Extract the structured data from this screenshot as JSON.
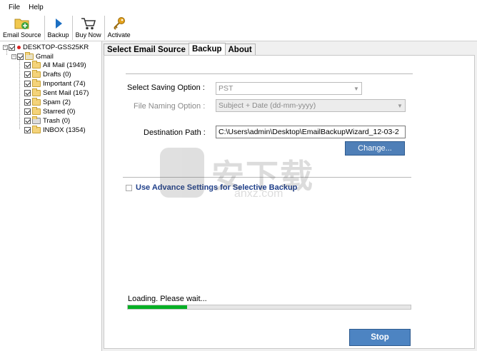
{
  "menu": [
    "File",
    "Help"
  ],
  "toolbar": {
    "email_source": "Email Source",
    "backup": "Backup",
    "buy_now": "Buy Now",
    "activate": "Activate"
  },
  "tree": {
    "root": "DESKTOP-GSS25KR",
    "account": "Gmail",
    "folders": [
      {
        "label": "All Mail (1949)"
      },
      {
        "label": "Drafts (0)"
      },
      {
        "label": "Important (74)"
      },
      {
        "label": "Sent Mail (167)"
      },
      {
        "label": "Spam (2)"
      },
      {
        "label": "Starred (0)"
      },
      {
        "label": "Trash (0)"
      },
      {
        "label": "INBOX (1354)"
      }
    ]
  },
  "tabs": [
    "Select Email Source",
    "Backup",
    "About"
  ],
  "active_tab": "Backup",
  "form": {
    "saving_option_label": "Select Saving Option :",
    "saving_option_value": "PST",
    "naming_option_label": "File Naming Option :",
    "naming_option_value": "Subject + Date (dd-mm-yyyy)",
    "destination_label": "Destination Path :",
    "destination_value": "C:\\Users\\admin\\Desktop\\EmailBackupWizard_12-03-2",
    "change_button": "Change...",
    "advance_settings": "Use Advance Settings for Selective Backup"
  },
  "status": {
    "loading_text": "Loading. Please wait...",
    "progress": 0.21
  },
  "stop_button": "Stop",
  "watermark": {
    "cn": "安下载",
    "en": "anxz.com"
  },
  "colors": {
    "progress_fill": "#06b025",
    "button_blue": "#4f7fb7",
    "link_blue": "#1f3f8a"
  }
}
